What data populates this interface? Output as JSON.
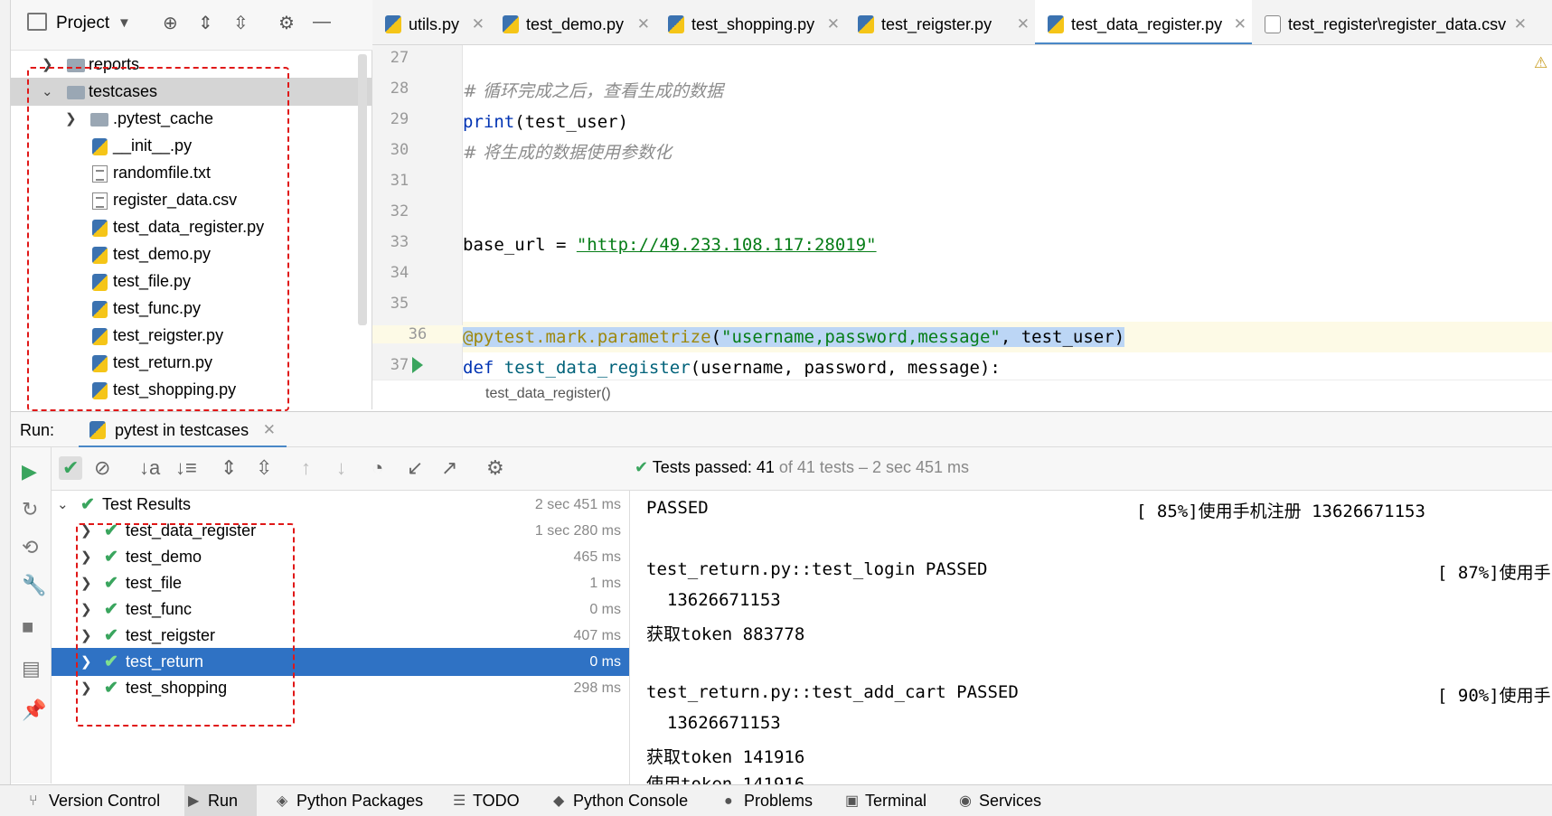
{
  "project_panel": {
    "title": "Project",
    "items": [
      {
        "label": "reports",
        "type": "folder",
        "expanded": false,
        "selected": false
      },
      {
        "label": "testcases",
        "type": "folder",
        "expanded": true,
        "selected": true
      },
      {
        "label": ".pytest_cache",
        "type": "folder",
        "expanded": false,
        "selected": false
      },
      {
        "label": "__init__.py",
        "type": "py",
        "selected": false
      },
      {
        "label": "randomfile.txt",
        "type": "txt",
        "selected": false
      },
      {
        "label": "register_data.csv",
        "type": "txt",
        "selected": false
      },
      {
        "label": "test_data_register.py",
        "type": "py",
        "selected": false
      },
      {
        "label": "test_demo.py",
        "type": "py",
        "selected": false
      },
      {
        "label": "test_file.py",
        "type": "py",
        "selected": false
      },
      {
        "label": "test_func.py",
        "type": "py",
        "selected": false
      },
      {
        "label": "test_reigster.py",
        "type": "py",
        "selected": false
      },
      {
        "label": "test_return.py",
        "type": "py",
        "selected": false
      },
      {
        "label": "test_shopping.py",
        "type": "py",
        "selected": false
      }
    ]
  },
  "editor_tabs": [
    {
      "label": "utils.py",
      "active": false,
      "icon": "python-file-icon"
    },
    {
      "label": "test_demo.py",
      "active": false,
      "icon": "python-file-icon"
    },
    {
      "label": "test_shopping.py",
      "active": false,
      "icon": "python-file-icon"
    },
    {
      "label": "test_reigster.py",
      "active": false,
      "icon": "python-file-icon"
    },
    {
      "label": "test_data_register.py",
      "active": true,
      "icon": "python-file-icon"
    },
    {
      "label": "test_register\\register_data.csv",
      "active": false,
      "icon": "csv-file-icon"
    }
  ],
  "editor": {
    "line_numbers": [
      "27",
      "28",
      "29",
      "30",
      "31",
      "32",
      "33",
      "34",
      "35",
      "36",
      "37"
    ],
    "comment1": "# 循环完成之后，查看生成的数据",
    "print_kw": "print",
    "print_args": "(test_user)",
    "comment2": "# 将生成的数据使用参数化",
    "base_url_var": "base_url = ",
    "base_url_value": "\"http://49.233.108.117:28019\"",
    "decorator": "@pytest.mark.parametrize",
    "decorator_open": "(",
    "decorator_str": "\"username,password,message\"",
    "decorator_rest": ", test_user)",
    "def_kw": "def ",
    "def_name": "test_data_register",
    "def_args": "(username, password, message):",
    "breadcrumb": "test_data_register()"
  },
  "run_panel": {
    "label": "Run:",
    "tab_label": "pytest in testcases",
    "status_prefix": "Tests passed: 41",
    "status_suffix": "of 41 tests – 2 sec 451 ms",
    "results": [
      {
        "name": "Test Results",
        "time": "2 sec 451 ms",
        "root": true,
        "selected": false
      },
      {
        "name": "test_data_register",
        "time": "1 sec 280 ms",
        "root": false,
        "selected": false
      },
      {
        "name": "test_demo",
        "time": "465 ms",
        "root": false,
        "selected": false
      },
      {
        "name": "test_file",
        "time": "1 ms",
        "root": false,
        "selected": false
      },
      {
        "name": "test_func",
        "time": "0 ms",
        "root": false,
        "selected": false
      },
      {
        "name": "test_reigster",
        "time": "407 ms",
        "root": false,
        "selected": false
      },
      {
        "name": "test_return",
        "time": "0 ms",
        "root": false,
        "selected": true
      },
      {
        "name": "test_shopping",
        "time": "298 ms",
        "root": false,
        "selected": false
      }
    ],
    "console": [
      {
        "text": "PASSED",
        "right": "[ 85%]使用手机注册 13626671153"
      },
      {
        "text": "",
        "right": ""
      },
      {
        "text": "test_return.py::test_login PASSED",
        "right": "[ 87%]使用手"
      },
      {
        "text": "  13626671153",
        "right": ""
      },
      {
        "text": "获取token 883778",
        "right": ""
      },
      {
        "text": "",
        "right": ""
      },
      {
        "text": "test_return.py::test_add_cart PASSED",
        "right": "[ 90%]使用手"
      },
      {
        "text": "  13626671153",
        "right": ""
      },
      {
        "text": "获取token 141916",
        "right": ""
      },
      {
        "text": "使用token 141916",
        "right": ""
      }
    ]
  },
  "status_bar": [
    {
      "label": "Version Control",
      "icon": "branch-icon",
      "active": false
    },
    {
      "label": "Run",
      "icon": "run-icon",
      "active": true
    },
    {
      "label": "Python Packages",
      "icon": "packages-icon",
      "active": false
    },
    {
      "label": "TODO",
      "icon": "list-icon",
      "active": false
    },
    {
      "label": "Python Console",
      "icon": "python-console-icon",
      "active": false
    },
    {
      "label": "Problems",
      "icon": "problems-icon",
      "active": false
    },
    {
      "label": "Terminal",
      "icon": "terminal-icon",
      "active": false
    },
    {
      "label": "Services",
      "icon": "services-icon",
      "active": false
    }
  ],
  "colors": {
    "accent": "#2f72c4",
    "pass_green": "#3aa55e",
    "annotation_red": "#e01818",
    "selection_highlight": "#bcd6f5"
  }
}
